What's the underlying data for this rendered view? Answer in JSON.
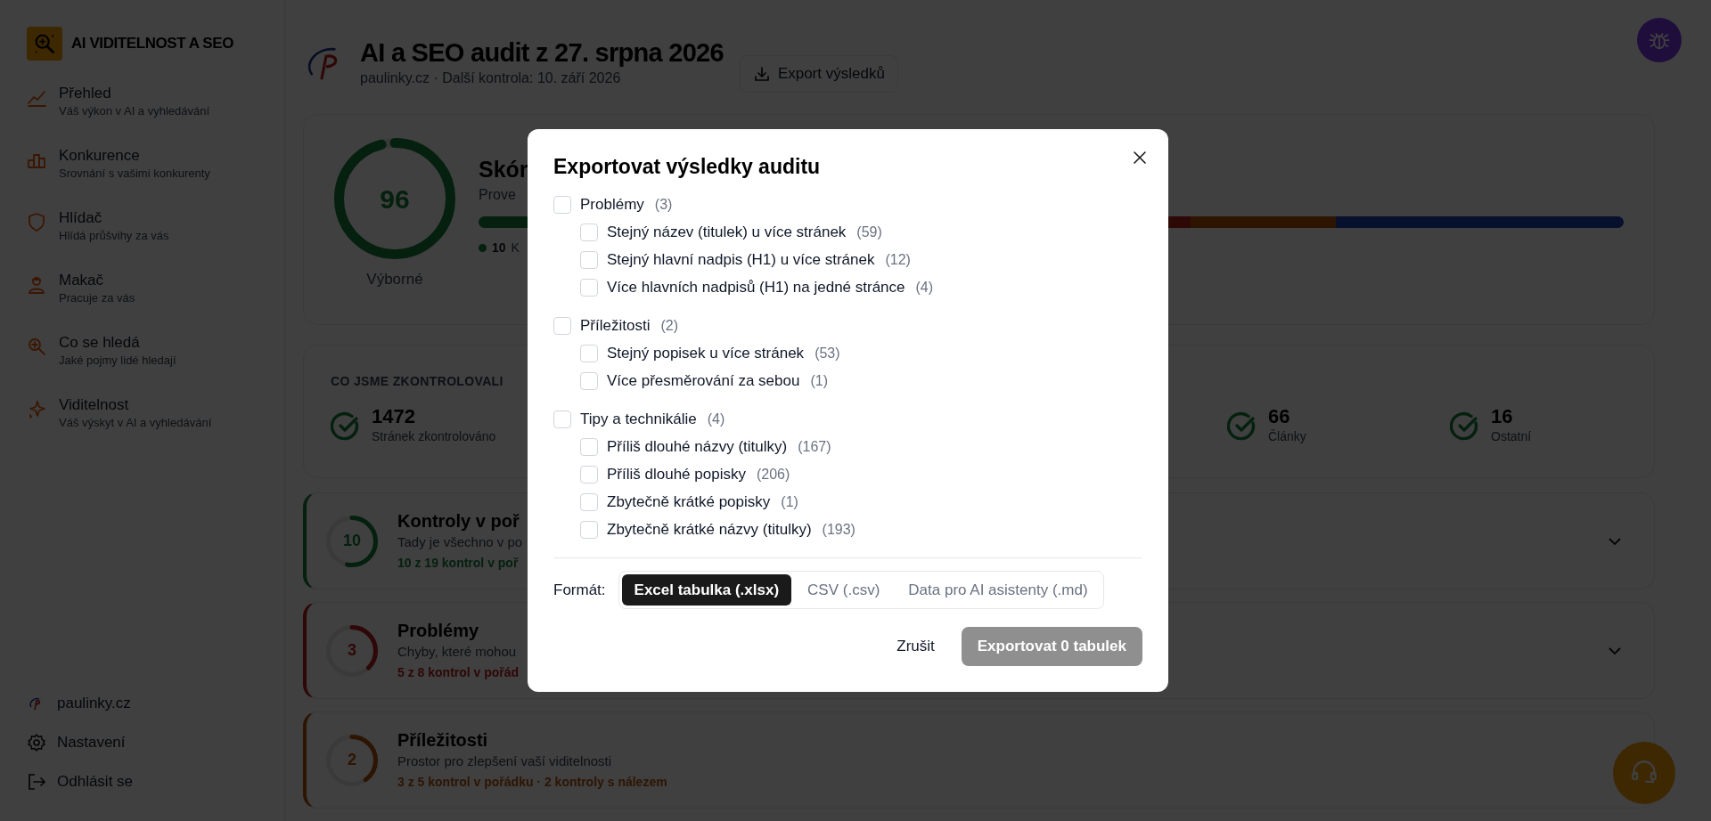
{
  "app": {
    "title": "AI VIDITELNOST A SEO"
  },
  "sidebar": {
    "items": [
      {
        "label": "Přehled",
        "description": "Váš výkon v AI a vyhledávání"
      },
      {
        "label": "Konkurence",
        "description": "Srovnání s vašimi konkurenty"
      },
      {
        "label": "Hlídač",
        "description": "Hlídá průšvihy za vás"
      },
      {
        "label": "Makač",
        "description": "Pracuje za vás"
      },
      {
        "label": "Co se hledá",
        "description": "Jaké pojmy lidé hledají"
      },
      {
        "label": "Viditelnost",
        "description": "Váš výskyt v AI a vyhledávání"
      }
    ],
    "footer": [
      {
        "label": "paulinky.cz"
      },
      {
        "label": "Nastavení"
      },
      {
        "label": "Odhlásit se"
      }
    ]
  },
  "header": {
    "title": "AI a SEO audit z 27. srpna 2026",
    "subtitle": "paulinky.cz · Další kontrola: 10. září 2026",
    "export_button": "Export výsledků"
  },
  "score_card": {
    "score": "96",
    "level": 0.96,
    "rating": "Výborné",
    "title": "Skór",
    "description": "Prove",
    "legend": [
      {
        "value": "10",
        "label": "K",
        "kind": "passed"
      }
    ]
  },
  "checked_card": {
    "heading": "CO JSME ZKONTROLOVALI",
    "stats": [
      {
        "value": "1472",
        "label": "Stránek zkontrolováno"
      },
      {
        "value": "66",
        "label": "Články"
      },
      {
        "value": "16",
        "label": "Ostatní"
      }
    ]
  },
  "sections": [
    {
      "count": "10",
      "level": 0.53,
      "kind": "passed",
      "title": "Kontroly v poř",
      "description": "Tady je všechno v po",
      "summary": "10 z 19 kontrol v poř",
      "expanded": false
    },
    {
      "count": "3",
      "level": 0.375,
      "kind": "problem",
      "title": "Problémy",
      "description": "Chyby, které mohou",
      "summary": "5 z 8 kontrol v pořád",
      "expanded": false
    },
    {
      "count": "2",
      "level": 0.4,
      "kind": "opportunity",
      "title": "Příležitosti",
      "description": "Prostor pro zlepšení vaší viditelnosti",
      "summary": "3 z 5 kontrol v pořádku · 2 kontroly s nálezem"
    }
  ],
  "dialog": {
    "title": "Exportovat výsledky auditu",
    "groups": [
      {
        "label": "Problémy",
        "count": "(3)",
        "checked": false,
        "children": [
          {
            "label": "Stejný název (titulek) u více stránek",
            "count": "(59)",
            "checked": false
          },
          {
            "label": "Stejný hlavní nadpis (H1) u více stránek",
            "count": "(12)",
            "checked": false
          },
          {
            "label": "Více hlavních nadpisů (H1) na jedné stránce",
            "count": "(4)",
            "checked": false
          }
        ]
      },
      {
        "label": "Příležitosti",
        "count": "(2)",
        "checked": false,
        "children": [
          {
            "label": "Stejný popisek u více stránek",
            "count": "(53)",
            "checked": false
          },
          {
            "label": "Více přesměrování za sebou",
            "count": "(1)",
            "checked": false
          }
        ]
      },
      {
        "label": "Tipy a technikálie",
        "count": "(4)",
        "checked": false,
        "children": [
          {
            "label": "Příliš dlouhé názvy (titulky)",
            "count": "(167)",
            "checked": false
          },
          {
            "label": "Příliš dlouhé popisky",
            "count": "(206)",
            "checked": false
          },
          {
            "label": "Zbytečně krátké popisky",
            "count": "(1)",
            "checked": false
          },
          {
            "label": "Zbytečně krátké názvy (titulky)",
            "count": "(193)",
            "checked": false
          }
        ]
      }
    ],
    "format_label": "Formát:",
    "formats": [
      {
        "label": "Excel tabulka (.xlsx)",
        "selected": true
      },
      {
        "label": "CSV (.csv)",
        "selected": false
      },
      {
        "label": "Data pro AI asistenty (.md)",
        "selected": false
      }
    ],
    "cancel": "Zrušit",
    "submit": {
      "label": "Exportovat 0 tabulek",
      "disabled": true
    }
  }
}
